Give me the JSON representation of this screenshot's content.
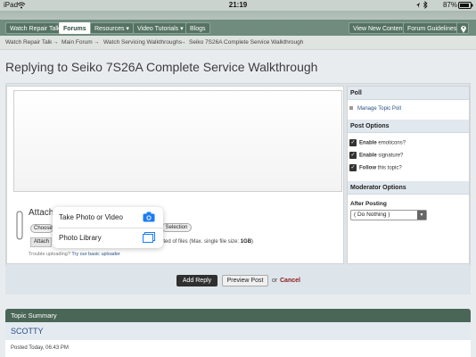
{
  "status_bar": {
    "carrier": "iPad",
    "time": "21:19",
    "battery": "87%",
    "icons": [
      "wifi-icon",
      "location-arrow-icon",
      "bluetooth-icon",
      "battery-icon"
    ]
  },
  "nav": {
    "tabs": [
      {
        "label": "Watch Repair Talk",
        "active": false
      },
      {
        "label": "Forums",
        "active": true
      },
      {
        "label": "Resources ▾",
        "active": false
      },
      {
        "label": "Video Tutorials ▾",
        "active": false
      },
      {
        "label": "Blogs",
        "active": false
      }
    ],
    "right_tabs": [
      "View New Content",
      "Forum Guidelines"
    ],
    "location_icon": "map-pin-icon"
  },
  "breadcrumb": [
    "Watch Repair Talk",
    "Main Forum",
    "Watch Servicing Walkthroughs",
    "Seiko 7S26A Complete Service Walkthrough"
  ],
  "breadcrumb_separator": "→",
  "page_title": "Replying to Seiko 7S26A Complete Service Walkthrough",
  "attach": {
    "title": "Attach",
    "choose_label": "Choose",
    "selection_label": "Selection",
    "attach_label": "Attach",
    "files_prefix": "ited of files (Max. single file size: ",
    "files_size": "1GB",
    "files_suffix": ")",
    "trouble_text": "Trouble uploading?",
    "trouble_link": "Try our basic uploader"
  },
  "popover": {
    "items": [
      {
        "label": "Take Photo or Video",
        "icon": "camera-icon"
      },
      {
        "label": "Photo Library",
        "icon": "photo-library-icon"
      }
    ]
  },
  "sidebar": {
    "poll_header": "Poll",
    "manage_poll": "Manage Topic Poll",
    "post_options_header": "Post Options",
    "options": [
      {
        "bold": "Enable",
        "rest": " emoticons?",
        "checked": true
      },
      {
        "bold": "Enable",
        "rest": " signature?",
        "checked": true
      },
      {
        "bold": "Follow",
        "rest": " this topic?",
        "checked": true
      }
    ],
    "moderator_header": "Moderator Options",
    "after_posting_label": "After Posting",
    "after_posting_value": "( Do Nothing )"
  },
  "actions": {
    "add_reply": "Add Reply",
    "preview_post": "Preview Post",
    "or": "or",
    "cancel": "Cancel"
  },
  "summary": {
    "header": "Topic Summary",
    "user": "SCOTTY",
    "posted": "Posted Today, 06:43 PM"
  },
  "colors": {
    "nav_bg": "#6f8c7e",
    "link_blue": "#2b4f86",
    "summary_header": "#4a6657",
    "ios_blue": "#1a7cf5"
  }
}
